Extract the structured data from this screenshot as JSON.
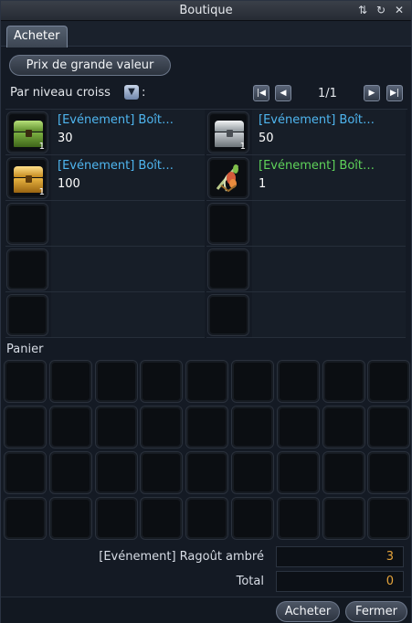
{
  "window": {
    "title": "Boutique",
    "icons": [
      "swap-arrows-icon",
      "refresh-icon",
      "close-icon"
    ]
  },
  "tabs": [
    {
      "label": "Acheter",
      "active": true
    }
  ],
  "high_value_button": "Prix de grande valeur",
  "sort": {
    "label": "Par niveau croiss",
    "suffix": ":"
  },
  "pager": {
    "page": "1/1"
  },
  "shop_items": [
    {
      "name": "[Evénement] Boît…",
      "price": "30",
      "qty": "1",
      "icon": "green-chest-icon",
      "name_color": "#4fb6f0"
    },
    {
      "name": "[Evénement] Boît…",
      "price": "50",
      "qty": "1",
      "icon": "silver-chest-icon",
      "name_color": "#4fb6f0"
    },
    {
      "name": "[Evénement] Boît…",
      "price": "100",
      "qty": "1",
      "icon": "gold-chest-icon",
      "name_color": "#4fb6f0"
    },
    {
      "name": "[Evénement] Boît…",
      "price": "1",
      "qty": "",
      "icon": "flower-box-icon",
      "name_color": "#5fd35a"
    }
  ],
  "cart": {
    "title": "Panier"
  },
  "summary": {
    "currency_label": "[Evénement] Ragoût ambré",
    "currency_value": "3",
    "total_label": "Total",
    "total_value": "0"
  },
  "footer": {
    "buy": "Acheter",
    "close": "Fermer"
  },
  "colors": {
    "accent_name": "#4fb6f0",
    "special_name": "#5fd35a",
    "value": "#e5a33b"
  }
}
